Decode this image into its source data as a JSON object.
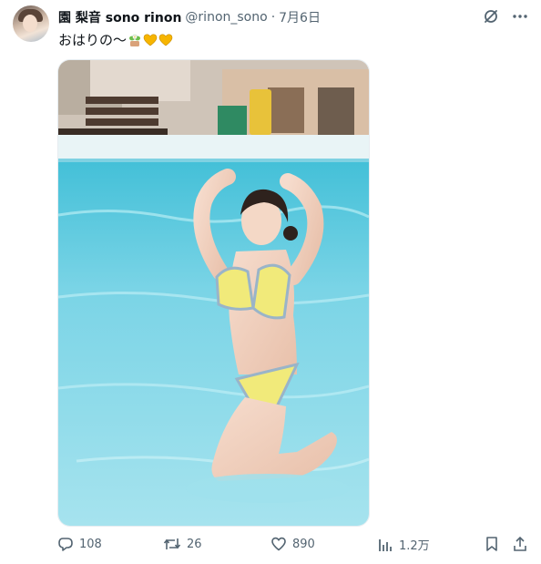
{
  "tweet": {
    "display_name": "園 梨音 sono rinon",
    "handle": "@rinon_sono",
    "separator": "·",
    "date": "7月6日",
    "text": "おはりの〜",
    "emojis": [
      "plant-emoji",
      "yellow-heart-emoji",
      "yellow-heart-emoji"
    ]
  },
  "actions": {
    "replies": "108",
    "retweets": "26",
    "likes": "890",
    "views": "1.2万"
  },
  "icons": {
    "grok": "grok-icon",
    "more": "more-icon",
    "reply": "reply-icon",
    "retweet": "retweet-icon",
    "like": "heart-icon",
    "views": "views-icon",
    "bookmark": "bookmark-icon",
    "share": "share-icon"
  },
  "colors": {
    "text": "#0f1419",
    "secondary": "#536471",
    "heart": "#f7b500",
    "pool": "#5cc5db"
  }
}
